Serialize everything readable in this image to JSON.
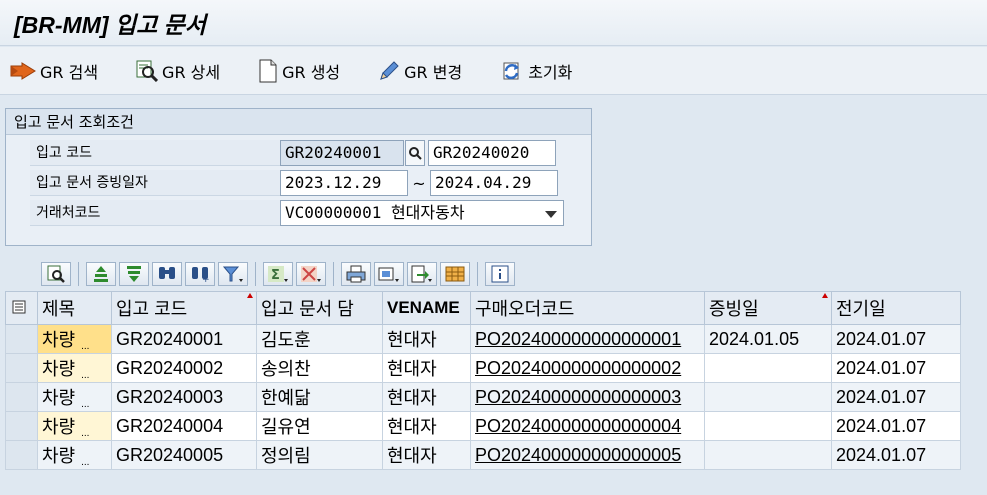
{
  "title": "[BR-MM] 입고 문서",
  "toolbar": {
    "buttons": [
      {
        "label": "GR 검색",
        "icon": "execute-arrow-icon"
      },
      {
        "label": "GR 상세",
        "icon": "detail-search-icon"
      },
      {
        "label": "GR 생성",
        "icon": "new-document-icon"
      },
      {
        "label": "GR 변경",
        "icon": "pencil-edit-icon"
      },
      {
        "label": "초기화",
        "icon": "refresh-icon"
      }
    ]
  },
  "criteria": {
    "title": "입고 문서 조회조건",
    "code_label": "입고 코드",
    "code_from": "GR20240001",
    "code_to": "GR20240020",
    "date_label": "입고 문서 증빙일자",
    "date_from": "2023.12.29",
    "date_to": "2024.04.29",
    "range_sep": "~",
    "vendor_label": "거래처코드",
    "vendor_value": "VC00000001 현대자동차"
  },
  "grid": {
    "headers": [
      "제목",
      "입고 코드",
      "입고 문서 담",
      "VENAME",
      "구매오더코드",
      "증빙일",
      "전기일"
    ],
    "rows": [
      {
        "cat": "차량",
        "dots": "...",
        "code": "GR20240001",
        "manager": "김도훈",
        "vendor": "현대자",
        "po": "PO202400000000000001",
        "doc_date": "2024.01.05",
        "post_date": "2024.01.07"
      },
      {
        "cat": "차량",
        "dots": "...",
        "code": "GR20240002",
        "manager": "송의찬",
        "vendor": "현대자",
        "po": "PO202400000000000002",
        "doc_date": "",
        "post_date": "2024.01.07"
      },
      {
        "cat": "차량",
        "dots": "...",
        "code": "GR20240003",
        "manager": "한예닮",
        "vendor": "현대자",
        "po": "PO202400000000000003",
        "doc_date": "",
        "post_date": "2024.01.07"
      },
      {
        "cat": "차량",
        "dots": "...",
        "code": "GR20240004",
        "manager": "길유연",
        "vendor": "현대자",
        "po": "PO202400000000000004",
        "doc_date": "",
        "post_date": "2024.01.07"
      },
      {
        "cat": "차량",
        "dots": "...",
        "code": "GR20240005",
        "manager": "정의림",
        "vendor": "현대자",
        "po": "PO202400000000000005",
        "doc_date": "",
        "post_date": "2024.01.07"
      }
    ]
  }
}
